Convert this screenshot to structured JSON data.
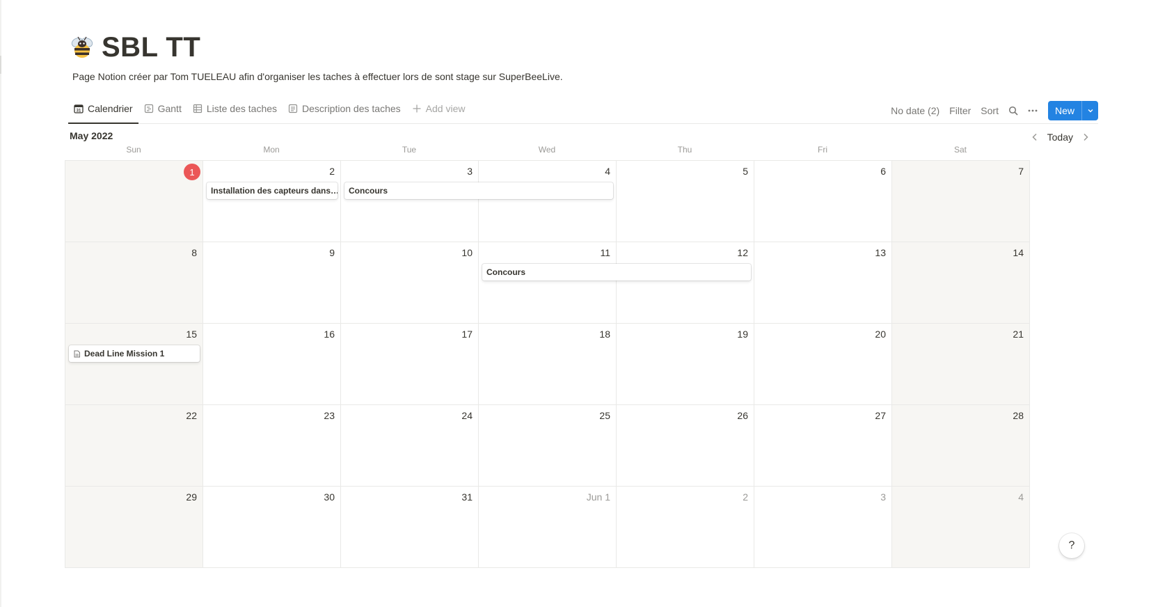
{
  "page": {
    "icon": "bee-icon",
    "title": "SBL TT",
    "description": "Page Notion créer par Tom TUELEAU afin d'organiser les taches à effectuer lors de sont stage sur SuperBeeLive."
  },
  "views": {
    "tabs": [
      {
        "label": "Calendrier",
        "icon": "calendar-icon",
        "active": true
      },
      {
        "label": "Gantt",
        "icon": "timeline-icon",
        "active": false
      },
      {
        "label": "Liste des taches",
        "icon": "table-icon",
        "active": false
      },
      {
        "label": "Description des taches",
        "icon": "list-icon",
        "active": false
      }
    ],
    "add_view": "Add view"
  },
  "toolbar": {
    "no_date": "No date (2)",
    "filter": "Filter",
    "sort": "Sort",
    "new": "New"
  },
  "calendar": {
    "month": "May 2022",
    "today": "Today",
    "weekdays": [
      "Sun",
      "Mon",
      "Tue",
      "Wed",
      "Thu",
      "Fri",
      "Sat"
    ],
    "weeks": [
      [
        "1",
        "2",
        "3",
        "4",
        "5",
        "6",
        "7"
      ],
      [
        "8",
        "9",
        "10",
        "11",
        "12",
        "13",
        "14"
      ],
      [
        "15",
        "16",
        "17",
        "18",
        "19",
        "20",
        "21"
      ],
      [
        "22",
        "23",
        "24",
        "25",
        "26",
        "27",
        "28"
      ],
      [
        "29",
        "30",
        "31",
        "Jun 1",
        "2",
        "3",
        "4"
      ]
    ],
    "events": [
      {
        "title": "Installation des capteurs dans…"
      },
      {
        "title": "Concours"
      },
      {
        "title": "Concours"
      },
      {
        "title": "Dead Line Mission 1",
        "icon": "page-icon"
      }
    ]
  },
  "help": "?",
  "colors": {
    "accent": "#2383e2",
    "today_badge": "#eb5757",
    "weekend_bg": "#f7f6f3"
  }
}
